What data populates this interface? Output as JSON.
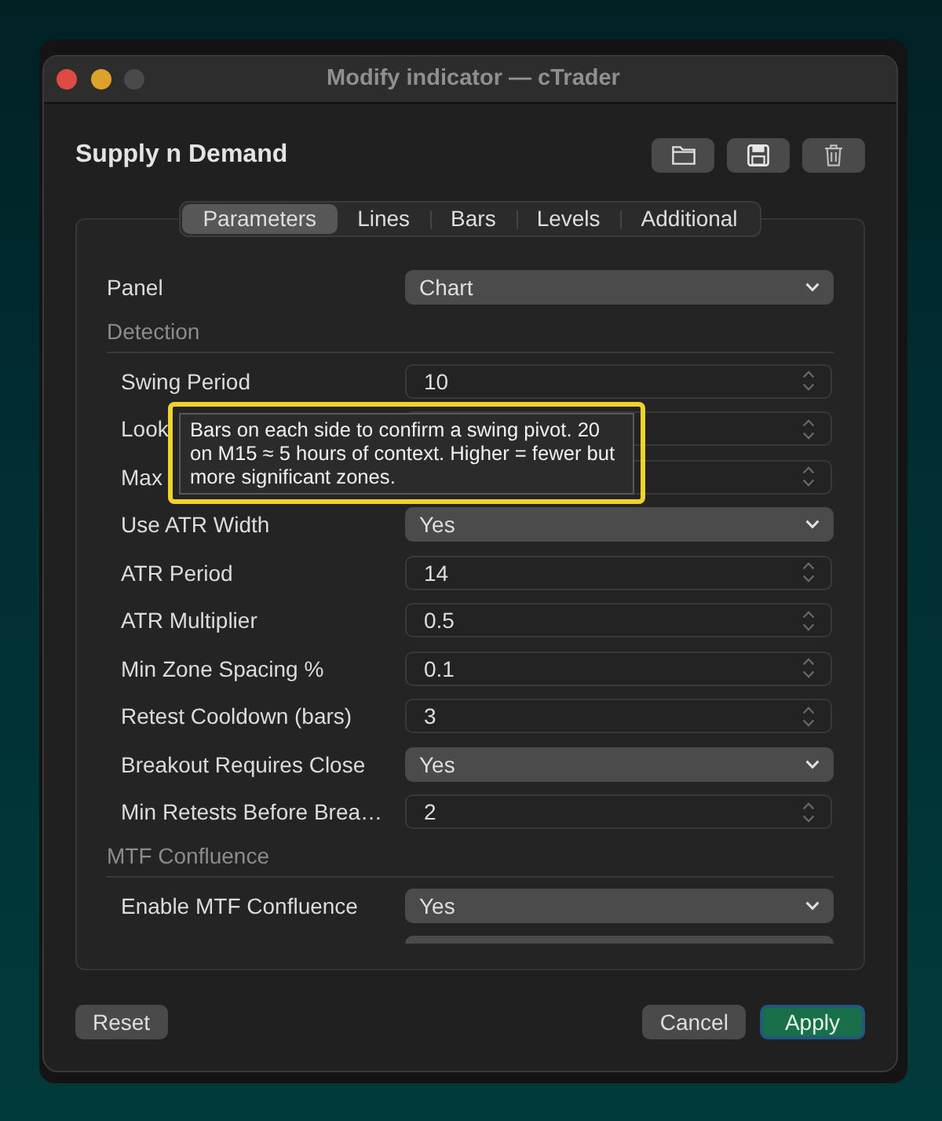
{
  "window": {
    "title": "Modify indicator — cTrader",
    "controls": [
      {
        "kind": "close",
        "disabled": false
      },
      {
        "kind": "minimize",
        "disabled": false
      },
      {
        "kind": "zoom",
        "disabled": true
      }
    ]
  },
  "header": {
    "title": "Supply n Demand",
    "actions": [
      {
        "kind": "folder"
      },
      {
        "kind": "save"
      },
      {
        "kind": "delete"
      }
    ]
  },
  "tabs": [
    {
      "label": "Parameters",
      "selected": true
    },
    {
      "label": "Lines",
      "selected": false
    },
    {
      "label": "Bars",
      "selected": false
    },
    {
      "label": "Levels",
      "selected": false
    },
    {
      "label": "Additional",
      "selected": false
    }
  ],
  "form": {
    "rows": [
      {
        "kind": "select",
        "label": "Panel",
        "value": "Chart"
      },
      {
        "kind": "section",
        "label": "Detection",
        "children": [
          {
            "kind": "number",
            "label": "Swing Period",
            "value": "10"
          },
          {
            "kind": "number",
            "label": "Look"
          },
          {
            "kind": "number",
            "label": "Max"
          },
          {
            "kind": "select",
            "label": "Use ATR Width",
            "value": "Yes"
          },
          {
            "kind": "number",
            "label": "ATR Period",
            "value": "14"
          },
          {
            "kind": "number",
            "label": "ATR Multiplier",
            "value": "0.5"
          },
          {
            "kind": "number",
            "label": "Min Zone Spacing %",
            "value": "0.1"
          },
          {
            "kind": "number",
            "label": "Retest Cooldown (bars)",
            "value": "3"
          },
          {
            "kind": "select",
            "label": "Breakout Requires Close",
            "value": "Yes"
          },
          {
            "kind": "number",
            "label": "Min Retests Before Brea…",
            "value": "2"
          }
        ]
      },
      {
        "kind": "section",
        "label": "MTF Confluence",
        "children": [
          {
            "kind": "select",
            "label": "Enable MTF Confluence",
            "value": "Yes"
          }
        ]
      }
    ]
  },
  "tooltip": {
    "text": "Bars on each side to confirm a swing pivot. 20 on M15 ≈ 5 hours of context. Higher = fewer but more significant zones."
  },
  "footer": {
    "left": [
      {
        "label": "Reset",
        "primary": false
      }
    ],
    "right": [
      {
        "label": "Cancel",
        "primary": false
      },
      {
        "label": "Apply",
        "primary": true
      }
    ]
  }
}
